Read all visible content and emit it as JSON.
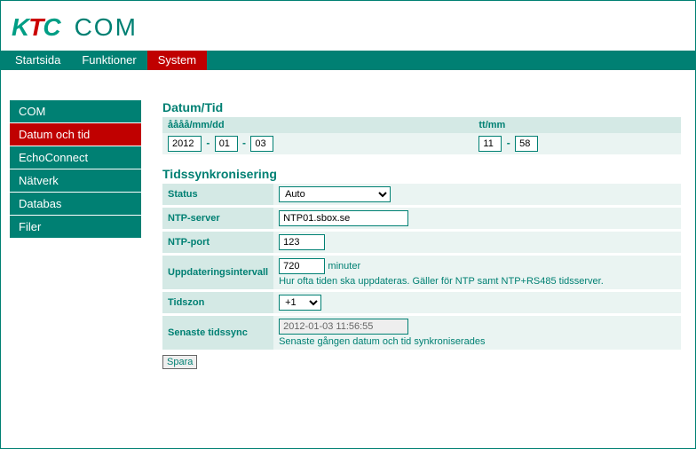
{
  "logo": {
    "brand_k": "K",
    "brand_t": "T",
    "brand_c": "C",
    "product": "COM"
  },
  "topnav": {
    "items": [
      {
        "label": "Startsida",
        "active": false
      },
      {
        "label": "Funktioner",
        "active": false
      },
      {
        "label": "System",
        "active": true
      }
    ]
  },
  "sidebar": {
    "items": [
      {
        "label": "COM",
        "active": false
      },
      {
        "label": "Datum och tid",
        "active": true
      },
      {
        "label": "EchoConnect",
        "active": false
      },
      {
        "label": "Nätverk",
        "active": false
      },
      {
        "label": "Databas",
        "active": false
      },
      {
        "label": "Filer",
        "active": false
      }
    ]
  },
  "datetime": {
    "heading": "Datum/Tid",
    "date_header": "åååå/mm/dd",
    "time_header": "tt/mm",
    "year": "2012",
    "month": "01",
    "day": "03",
    "hour": "11",
    "minute": "58"
  },
  "sync": {
    "heading": "Tidssynkronisering",
    "status_label": "Status",
    "status_value": "Auto",
    "ntp_server_label": "NTP-server",
    "ntp_server_value": "NTP01.sbox.se",
    "ntp_port_label": "NTP-port",
    "ntp_port_value": "123",
    "interval_label": "Uppdateringsintervall",
    "interval_value": "720",
    "interval_unit": "minuter",
    "interval_help": "Hur ofta tiden ska uppdateras. Gäller för NTP samt NTP+RS485 tidsserver.",
    "tz_label": "Tidszon",
    "tz_value": "+1",
    "last_label": "Senaste tidssync",
    "last_value": "2012-01-03 11:56:55",
    "last_help": "Senaste gången datum och tid synkroniserades"
  },
  "buttons": {
    "save": "Spara"
  }
}
